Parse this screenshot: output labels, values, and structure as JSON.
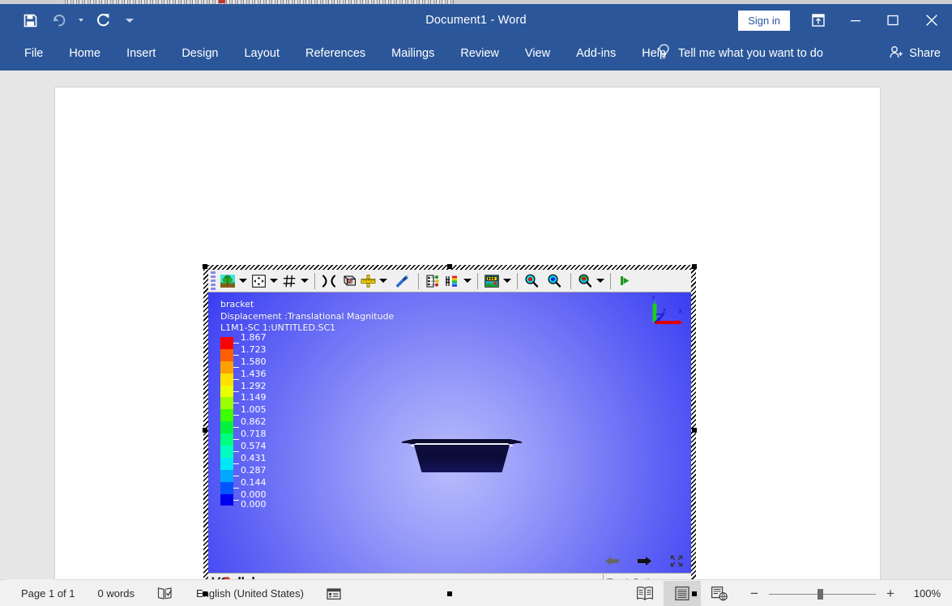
{
  "window": {
    "title": "Document1  -  Word",
    "sign_in_label": "Sign in",
    "ribbon_display_icon": "ribbon-display-options-icon",
    "minimize_icon": "minimize-icon",
    "maximize_icon": "maximize-icon",
    "close_icon": "close-icon"
  },
  "quick_access": [
    {
      "name": "save-icon",
      "label": "Save"
    },
    {
      "name": "undo-icon",
      "label": "Undo"
    },
    {
      "name": "redo-icon",
      "label": "Redo"
    },
    {
      "name": "customize-qat-icon",
      "label": "Customize Quick Access Toolbar"
    }
  ],
  "ribbon": {
    "tabs": [
      {
        "label": "File"
      },
      {
        "label": "Home"
      },
      {
        "label": "Insert"
      },
      {
        "label": "Design"
      },
      {
        "label": "Layout"
      },
      {
        "label": "References"
      },
      {
        "label": "Mailings"
      },
      {
        "label": "Review"
      },
      {
        "label": "View"
      },
      {
        "label": "Add-ins"
      },
      {
        "label": "Help"
      }
    ],
    "tell_me": "Tell me what you want to do",
    "share": "Share"
  },
  "embedded_object": {
    "app_name": "VCollab",
    "toolbar": [
      {
        "name": "scene-background-icon",
        "has_caret": true
      },
      {
        "name": "fit-view-icon",
        "has_caret": true
      },
      {
        "name": "grid-icon",
        "has_caret": true
      },
      {
        "separator": true
      },
      {
        "name": "free-rotate-icon",
        "has_caret": false
      },
      {
        "name": "bounding-box-icon",
        "has_caret": false
      },
      {
        "name": "measure-icon",
        "has_caret": true
      },
      {
        "name": "probe-icon",
        "has_caret": false
      },
      {
        "separator": true
      },
      {
        "name": "model-tree-icon",
        "has_caret": false
      },
      {
        "name": "contour-legend-icon",
        "has_caret": true
      },
      {
        "separator": true
      },
      {
        "name": "result-map-icon",
        "has_caret": true
      },
      {
        "separator": true
      },
      {
        "name": "zoom-red-icon",
        "has_caret": false
      },
      {
        "name": "zoom-blue-icon",
        "has_caret": false
      },
      {
        "separator": true
      },
      {
        "name": "zoom-probe-icon",
        "has_caret": true
      },
      {
        "separator": true
      },
      {
        "name": "overflow-arrow-icon",
        "has_caret": false
      }
    ],
    "viewport": {
      "model_name": "bracket",
      "result_title": "Displacement :Translational Magnitude",
      "step_info": "L1M1-SC 1:UNTITLED.SC1",
      "axis_triad": {
        "x_label": "X",
        "y_label": "Y",
        "z_label": "Z",
        "x_color": "#e00000",
        "y_color": "#19d219",
        "z_color": "#1a1acc"
      },
      "nav": [
        {
          "name": "previous-state-icon"
        },
        {
          "name": "next-state-icon"
        },
        {
          "name": "fit-to-window-icon"
        }
      ]
    },
    "status": {
      "logo": "VCollab",
      "mode": "Track Ball"
    }
  },
  "chart_data": {
    "type": "heatmap",
    "title": "Displacement :Translational Magnitude",
    "subtitle": "bracket",
    "annotation": "L1M1-SC 1:UNTITLED.SC1",
    "colorbar_label": "",
    "legend_position": "left",
    "ticks": [
      {
        "value": "1.867",
        "color": "#ff0000"
      },
      {
        "value": "1.723",
        "color": "#ff5f00"
      },
      {
        "value": "1.580",
        "color": "#ffa000"
      },
      {
        "value": "1.436",
        "color": "#ffe000"
      },
      {
        "value": "1.292",
        "color": "#eaff00"
      },
      {
        "value": "1.149",
        "color": "#9bff00"
      },
      {
        "value": "1.005",
        "color": "#3cff00"
      },
      {
        "value": "0.862",
        "color": "#00f23c"
      },
      {
        "value": "0.718",
        "color": "#00ff7d"
      },
      {
        "value": "0.574",
        "color": "#00ffbe"
      },
      {
        "value": "0.431",
        "color": "#00e8f5"
      },
      {
        "value": "0.287",
        "color": "#00a8ff"
      },
      {
        "value": "0.144",
        "color": "#0055ff"
      },
      {
        "value": "0.000",
        "color": "#0000f0"
      }
    ],
    "vmin": "0.000",
    "vmax": "1.867"
  },
  "statusbar": {
    "page": "Page 1 of 1",
    "words": "0 words",
    "proofing_icon": "proofing-errors-icon",
    "language": "English (United States)",
    "accessibility_icon": "accessibility-checker-icon",
    "views": [
      {
        "name": "read-mode-icon",
        "active": false
      },
      {
        "name": "print-layout-icon",
        "active": true
      },
      {
        "name": "web-layout-icon",
        "active": false
      }
    ],
    "zoom_out": "−",
    "zoom_in": "+",
    "zoom_level": "100%"
  }
}
